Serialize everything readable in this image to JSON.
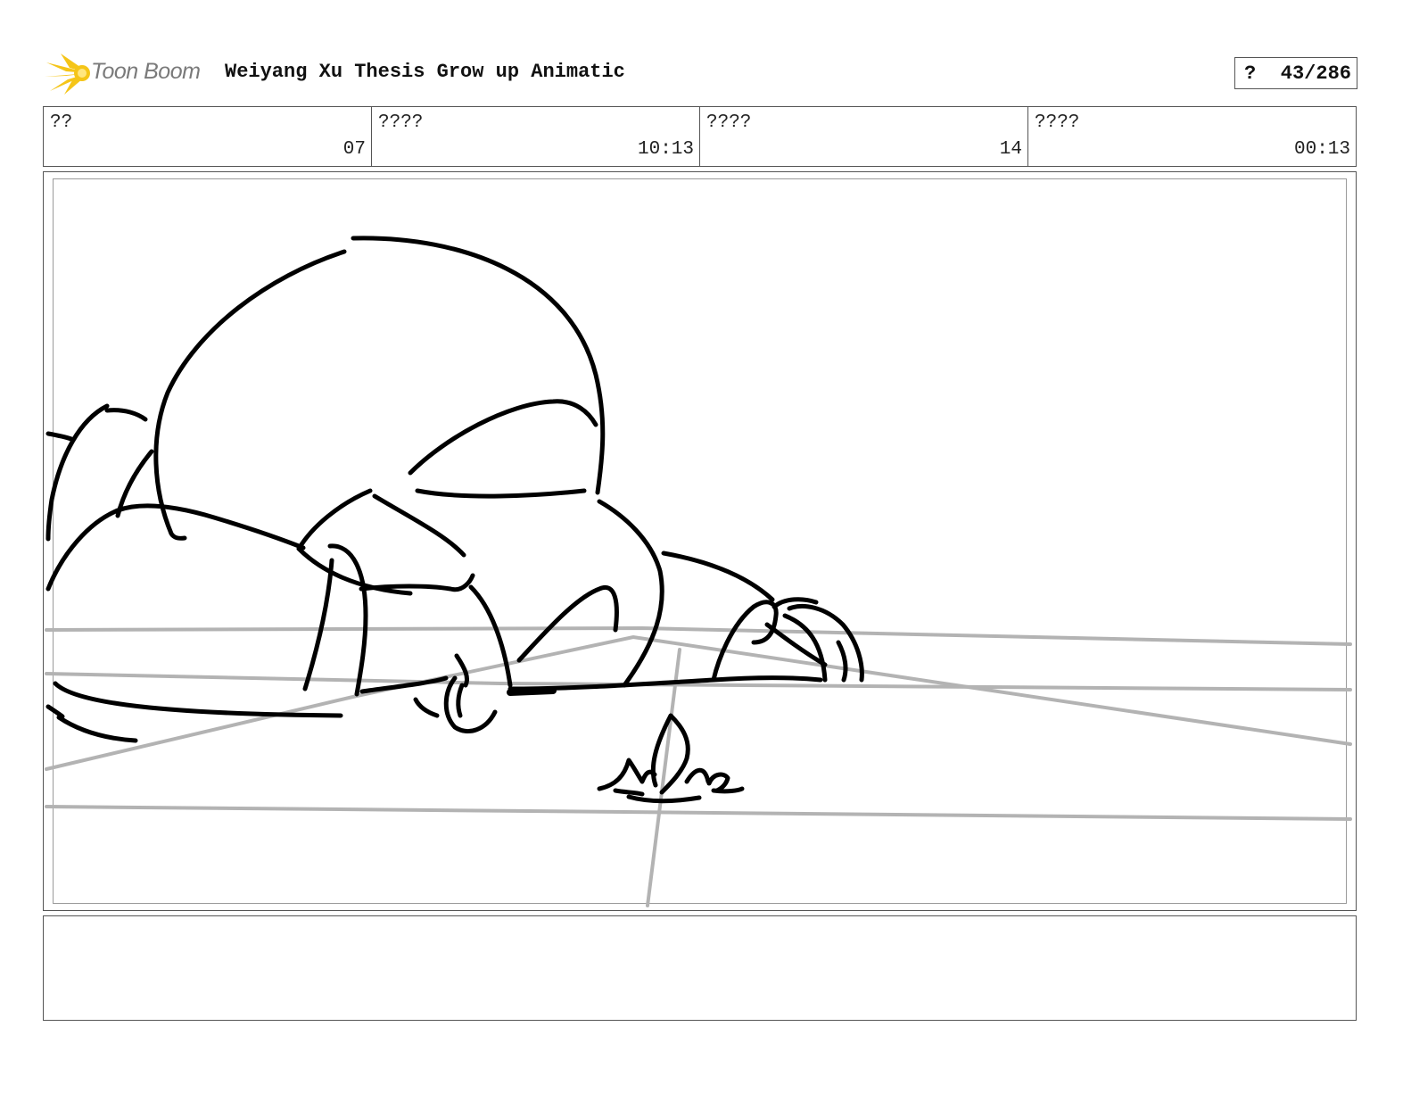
{
  "header": {
    "logo_text": "Toon Boom",
    "project_title": "Weiyang Xu Thesis Grow up Animatic",
    "page_label": "?",
    "page_number": "43/286"
  },
  "info": [
    {
      "label": "??",
      "value": "07"
    },
    {
      "label": "????",
      "value": "10:13"
    },
    {
      "label": "????",
      "value": "14"
    },
    {
      "label": "????",
      "value": "00:13"
    }
  ],
  "notes": {
    "text": ""
  },
  "colors": {
    "logo_accent": "#f5c518",
    "frame_border": "#555555",
    "guide_lines": "#b3b3b3"
  }
}
